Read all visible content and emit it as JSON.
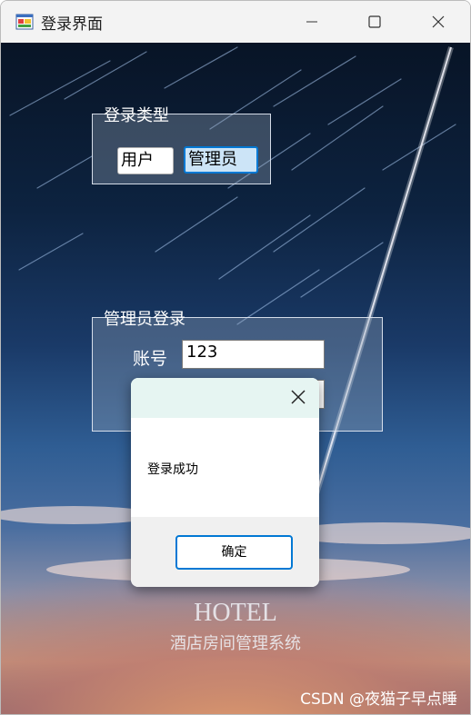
{
  "window": {
    "title": "登录界面"
  },
  "login_type": {
    "legend": "登录类型",
    "options": [
      "用户",
      "管理员"
    ],
    "selected": "管理员"
  },
  "admin_login": {
    "legend": "管理员登录",
    "account_label": "账号",
    "account_value": "123",
    "password_value": ""
  },
  "branding": {
    "title": "HOTEL",
    "subtitle": "酒店房间管理系统"
  },
  "dialog": {
    "message": "登录成功",
    "ok_label": "确定"
  },
  "watermark": "CSDN @夜猫子早点睡",
  "colors": {
    "accent": "#0078d4",
    "dialog_header": "#e6f5f2",
    "titlebar": "#f3f3f3"
  }
}
